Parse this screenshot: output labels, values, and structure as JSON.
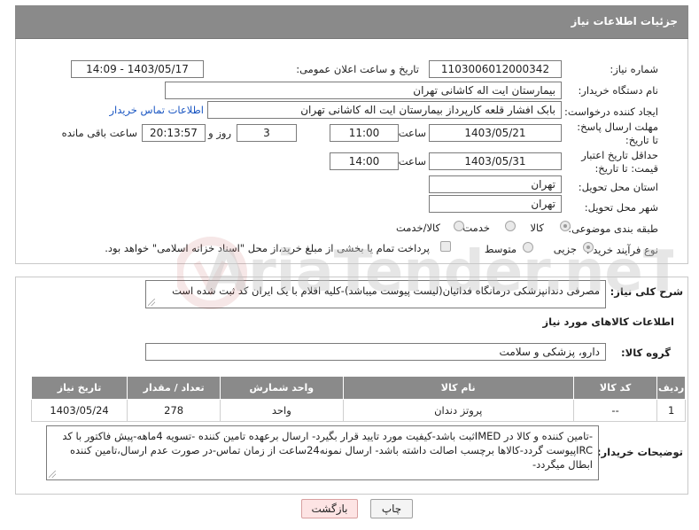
{
  "header": {
    "title": "جزئیات اطلاعات نیاز"
  },
  "form": {
    "need_number_label": "شماره نیاز:",
    "need_number": "1103006012000342",
    "announce_label": "تاریخ و ساعت اعلان عمومی:",
    "announce_value": "1403/05/17 - 14:09",
    "buyer_org_label": "نام دستگاه خریدار:",
    "buyer_org": "بیمارستان ایت اله کاشانی تهران",
    "creator_label": "ایجاد کننده درخواست:",
    "creator": "بابک افشار قلعه کارپرداز بیمارستان ایت اله کاشانی تهران",
    "contact_link": "اطلاعات تماس خریدار",
    "deadline_label": "مهلت ارسال پاسخ: تا تاریخ:",
    "deadline_date": "1403/05/21",
    "time_label": "ساعت",
    "deadline_time": "11:00",
    "days_value": "3",
    "days_label": "روز و",
    "remaining_time": "20:13:57",
    "remaining_label": "ساعت باقی مانده",
    "validity_label": "حداقل تاریخ اعتبار قیمت: تا تاریخ:",
    "validity_date": "1403/05/31",
    "validity_time": "14:00",
    "province_label": "استان محل تحویل:",
    "province": "تهران",
    "city_label": "شهر محل تحویل:",
    "city": "تهران",
    "category_label": "طبقه بندی موضوعی:",
    "category_options": [
      "کالا",
      "خدمت",
      "کالا/خدمت"
    ],
    "process_label": "نوع فرآیند خرید :",
    "process_options": [
      "جزیی",
      "متوسط"
    ],
    "payment_note": "پرداخت تمام یا بخشی از مبلغ خرید،از محل \"اسناد خزانه اسلامی\" خواهد بود."
  },
  "summary": {
    "label": "شرح کلی نیاز:",
    "text": "مصرفی دندانپزشکی درمانگاه فدائیان(لیست پیوست میباشد)-کلیه اقلام با یک ایران کد ثبت شده است"
  },
  "goods": {
    "section_title": "اطلاعات کالاهای مورد نیاز",
    "group_label": "گروه کالا:",
    "group_value": "دارو، پزشکی و سلامت",
    "columns": [
      "ردیف",
      "کد کالا",
      "نام کالا",
      "واحد شمارش",
      "تعداد / مقدار",
      "تاریخ نیاز"
    ],
    "rows": [
      {
        "row": "1",
        "code": "--",
        "name": "پروتز دندان",
        "unit": "واحد",
        "qty": "278",
        "date": "1403/05/24"
      }
    ]
  },
  "buyer_notes": {
    "label": "توضیحات خریدار:",
    "text": "-تامین کننده و کالا در IMEDثبت باشد-کیفیت مورد تایید قرار بگیرد- ارسال برعهده تامین کننده -تسویه 4ماهه-پیش فاکتور با کد IRCپیوست گردد-کالاها برچسب اصالت داشته باشد- ارسال نمونه24ساعت از زمان تماس-در صورت عدم ارسال،تامین کننده ابطال میگردد-"
  },
  "buttons": {
    "print": "چاپ",
    "back": "بازگشت"
  },
  "watermark": "AriaTender.neT"
}
